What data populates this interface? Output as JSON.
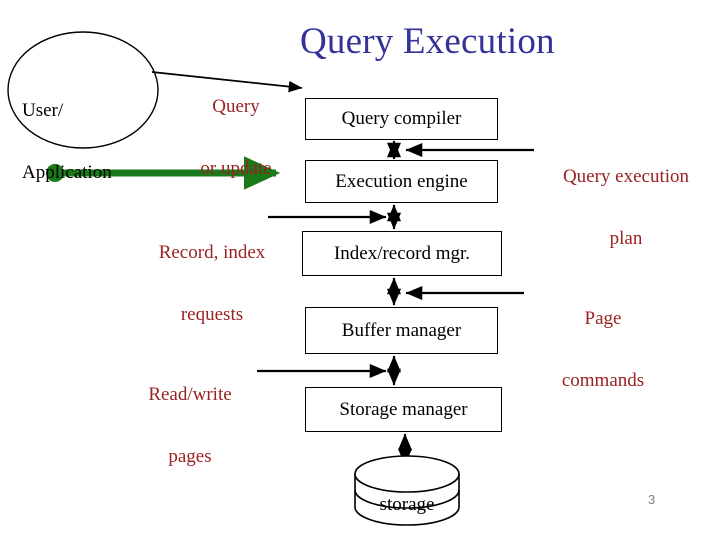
{
  "slide": {
    "title": "Query Execution",
    "slide_number": "3",
    "title_color": "#333399",
    "label_color": "#992222",
    "flow_arrow_color": "#1a7a1a"
  },
  "actor": {
    "label_line1": "User/",
    "label_line2": "Application"
  },
  "boxes": [
    {
      "id": "query-compiler",
      "label": "Query compiler"
    },
    {
      "id": "execution-engine",
      "label": "Execution engine"
    },
    {
      "id": "index-record-mgr",
      "label": "Index/record mgr."
    },
    {
      "id": "buffer-manager",
      "label": "Buffer manager"
    },
    {
      "id": "storage-manager",
      "label": "Storage manager"
    }
  ],
  "storage": {
    "label": "storage"
  },
  "annotations": {
    "query_or_update_line1": "Query",
    "query_or_update_line2": "or update",
    "record_index_line1": "Record, index",
    "record_index_line2": "requests",
    "read_write_line1": "Read/write",
    "read_write_line2": "pages",
    "query_execution_plan_line1": "Query execution",
    "query_execution_plan_line2": "plan",
    "page_commands_line1": "Page",
    "page_commands_line2": "commands"
  }
}
